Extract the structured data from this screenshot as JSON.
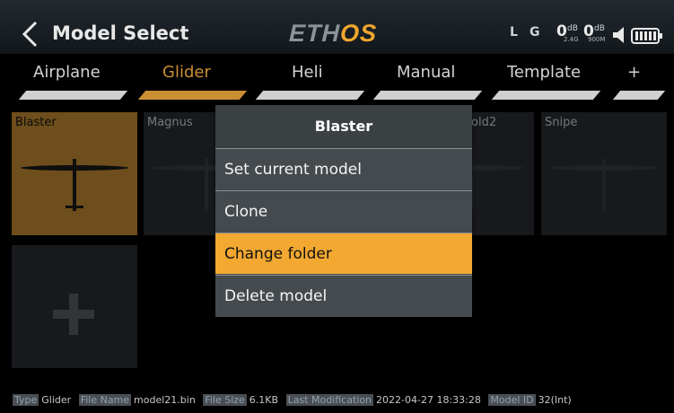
{
  "header": {
    "title": "Model Select",
    "logo_left": "ETH",
    "logo_right": "OS",
    "status_l": "L",
    "status_g": "G",
    "rssi_1": "0",
    "rssi_1_unit": "dB",
    "rssi_1_sub": "2.4G",
    "rssi_2": "0",
    "rssi_2_unit": "dB",
    "rssi_2_sub": "900M"
  },
  "tabs": [
    {
      "label": "Airplane"
    },
    {
      "label": "Glider"
    },
    {
      "label": "Heli"
    },
    {
      "label": "Manual"
    },
    {
      "label": "Template"
    },
    {
      "label": "+"
    }
  ],
  "models": [
    {
      "name": "Blaster"
    },
    {
      "name": "Magnus"
    },
    {
      "name": "old2"
    },
    {
      "name": "Snipe"
    }
  ],
  "context_menu": {
    "title": "Blaster",
    "items": [
      {
        "label": "Set current model"
      },
      {
        "label": "Clone"
      },
      {
        "label": "Change folder"
      },
      {
        "label": "Delete model"
      }
    ]
  },
  "footer": {
    "type_key": "Type",
    "type_val": "Glider",
    "file_key": "File Name",
    "file_val": "model21.bin",
    "size_key": "File Size",
    "size_val": "6.1KB",
    "mod_key": "Last Modification",
    "mod_val": "2022-04-27 18:33:28",
    "id_key": "Model ID",
    "id_val": "32(Int)"
  },
  "colors": {
    "accent": "#c98f33",
    "menu_highlight": "#f2a831"
  }
}
